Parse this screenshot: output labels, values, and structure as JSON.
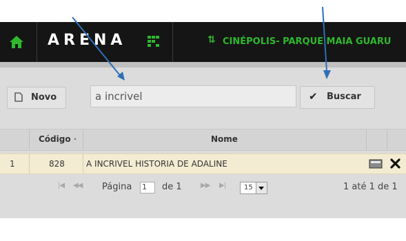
{
  "header": {
    "home_icon": "home-icon",
    "logo_text": "ARENA",
    "cinema_icon": "sort-arrows-icon",
    "cinema_name": "CINÉPOLIS- PARQUE MAIA GUARU",
    "brand_color": "#2eb82e"
  },
  "toolbar": {
    "new_label": "Novo",
    "new_icon": "document-icon",
    "search_value": "a incrivel",
    "search_label": "Buscar",
    "search_icon": "check-icon"
  },
  "grid": {
    "columns": [
      "",
      "Código",
      "Nome",
      "",
      ""
    ],
    "code_sort_marker": "·",
    "rows": [
      {
        "index": "1",
        "code": "828",
        "name": "A INCRIVEL HISTORIA DE ADALINE",
        "edit_icon": "card-icon",
        "delete_icon": "close-icon"
      }
    ]
  },
  "pager": {
    "first_label": "|◀",
    "prev_label": "◀◀",
    "page_label": "Página",
    "page_value": "1",
    "of_label": "de 1",
    "next_label": "▶▶",
    "last_label": "▶|",
    "rows_per_page": "15",
    "summary": "1 até 1 de 1"
  },
  "annotation_color": "#2e6fb8"
}
